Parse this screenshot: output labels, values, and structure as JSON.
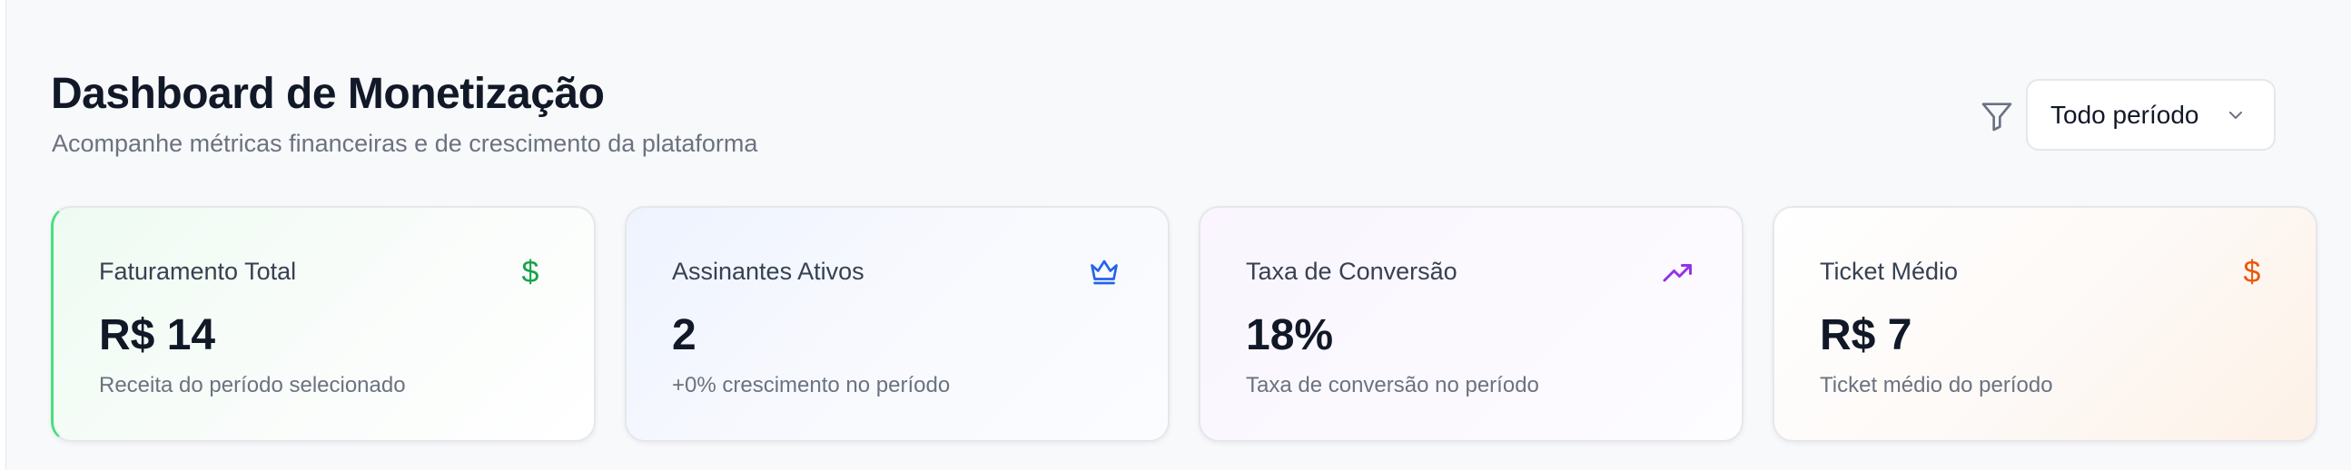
{
  "header": {
    "title": "Dashboard de Monetização",
    "subtitle": "Acompanhe métricas financeiras e de crescimento da plataforma"
  },
  "filter": {
    "icon": "filter-icon",
    "selected": "Todo período",
    "dropdown_icon": "chevron-down-icon"
  },
  "cards": [
    {
      "label": "Faturamento Total",
      "value": "R$ 14",
      "description": "Receita do período selecionado",
      "icon": "dollar-icon",
      "icon_glyph": "$",
      "icon_color": "#16a34a"
    },
    {
      "label": "Assinantes Ativos",
      "value": "2",
      "description": "+0% crescimento no período",
      "icon": "crown-icon",
      "icon_color": "#2563eb"
    },
    {
      "label": "Taxa de Conversão",
      "value": "18%",
      "description": "Taxa de conversão no período",
      "icon": "trending-up-icon",
      "icon_color": "#9333ea"
    },
    {
      "label": "Ticket Médio",
      "value": "R$ 7",
      "description": "Ticket médio do período",
      "icon": "dollar-icon",
      "icon_glyph": "$",
      "icon_color": "#ea580c"
    }
  ]
}
